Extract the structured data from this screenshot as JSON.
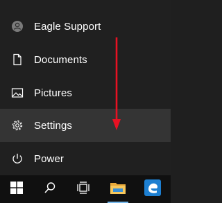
{
  "start_menu": {
    "user": {
      "label": "Eagle Support",
      "icon": "user-avatar-icon"
    },
    "items": [
      {
        "label": "Documents",
        "icon": "document-icon"
      },
      {
        "label": "Pictures",
        "icon": "pictures-icon"
      },
      {
        "label": "Settings",
        "icon": "gear-icon",
        "highlighted": true
      },
      {
        "label": "Power",
        "icon": "power-icon"
      }
    ]
  },
  "annotation": {
    "type": "arrow",
    "direction": "down",
    "color": "#e81123"
  },
  "taskbar": {
    "buttons": [
      {
        "name": "start",
        "icon": "windows-logo-icon"
      },
      {
        "name": "search",
        "icon": "search-icon"
      },
      {
        "name": "task-view",
        "icon": "task-view-icon"
      },
      {
        "name": "file-explorer",
        "icon": "folder-icon",
        "active": true
      },
      {
        "name": "edge",
        "icon": "edge-icon"
      }
    ],
    "accent_color": "#76b9ed"
  },
  "colors": {
    "menu_background": "#202020",
    "hover_background": "#343434",
    "taskbar_background": "#101010"
  }
}
